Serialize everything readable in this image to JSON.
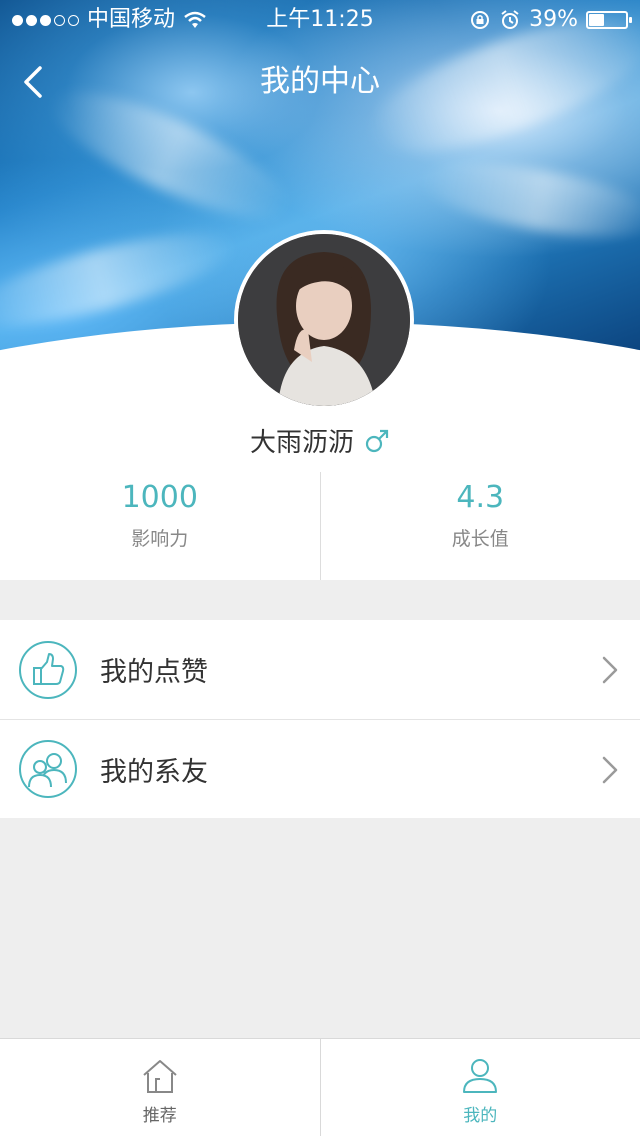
{
  "status_bar": {
    "carrier": "中国移动",
    "time": "上午11:25",
    "battery": "39%",
    "battery_level": 0.39
  },
  "nav": {
    "title": "我的中心",
    "back_icon": "back-arrow-icon"
  },
  "profile": {
    "username": "大雨沥沥",
    "gender_icon": "male-icon",
    "stats": [
      {
        "value": "1000",
        "label": "影响力"
      },
      {
        "value": "4.3",
        "label": "成长值"
      }
    ]
  },
  "menu": {
    "items": [
      {
        "label": "我的点赞",
        "icon": "thumbs-up-icon"
      },
      {
        "label": "我的系友",
        "icon": "friends-icon"
      }
    ]
  },
  "tabbar": {
    "items": [
      {
        "label": "推荐",
        "icon": "home-icon",
        "active": false
      },
      {
        "label": "我的",
        "icon": "user-icon",
        "active": true
      }
    ]
  },
  "colors": {
    "accent": "#4cb6bd",
    "background": "#eeeeee"
  }
}
